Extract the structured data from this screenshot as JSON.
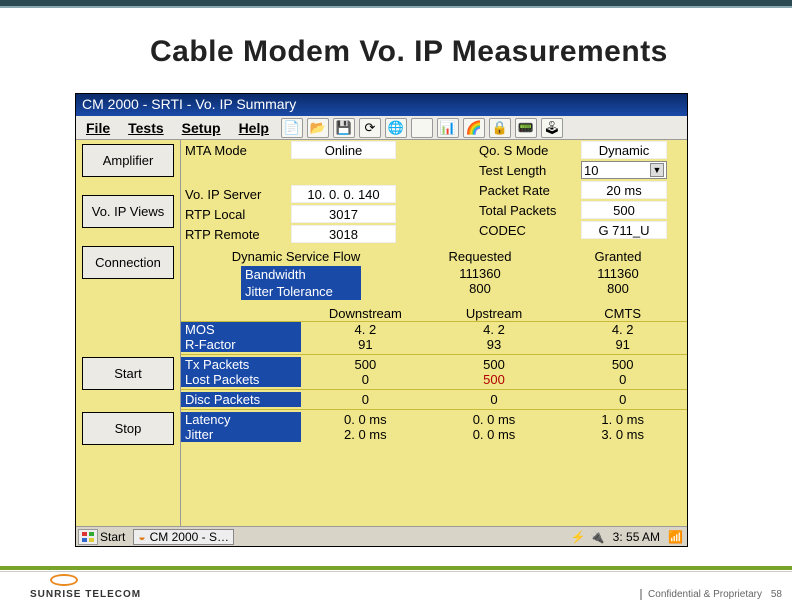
{
  "slide": {
    "title": "Cable Modem Vo. IP Measurements"
  },
  "window": {
    "title": "CM 2000 - SRTI - Vo. IP Summary"
  },
  "menu": {
    "file": "File",
    "tests": "Tests",
    "setup": "Setup",
    "help": "Help"
  },
  "toolbar": {
    "i1": "📄",
    "i2": "📂",
    "i3": "💾",
    "i4": "⟳",
    "i5": "🌐",
    "i6": "",
    "i7": "📊",
    "i8": "🌈",
    "i9": "🔒",
    "i10": "📟",
    "i11": "🕹"
  },
  "sidebar": {
    "amplifier": "Amplifier",
    "voip_views": "Vo. IP Views",
    "connection": "Connection",
    "start": "Start",
    "stop": "Stop"
  },
  "top": {
    "mta_mode": "MTA Mode",
    "mta_mode_val": "Online",
    "voip_server": "Vo. IP Server",
    "voip_server_val": "10. 0. 0. 140",
    "rtp_local": "RTP Local",
    "rtp_local_val": "3017",
    "rtp_remote": "RTP Remote",
    "rtp_remote_val": "3018",
    "qos_mode": "Qo. S Mode",
    "qos_mode_val": "Dynamic",
    "test_length": "Test Length",
    "test_length_val": "10",
    "packet_rate": "Packet Rate",
    "packet_rate_val": "20 ms",
    "total_packets": "Total Packets",
    "total_packets_val": "500",
    "codec": "CODEC",
    "codec_val": "G 711_U",
    "dsf": "Dynamic Service Flow",
    "requested": "Requested",
    "granted": "Granted",
    "bandwidth": "Bandwidth",
    "bw_req": "111360",
    "bw_grant": "111360",
    "jitter_tol": "Jitter Tolerance",
    "jt_req": "800",
    "jt_grant": "800"
  },
  "stats": {
    "cols": {
      "downstream": "Downstream",
      "upstream": "Upstream",
      "cmts": "CMTS"
    },
    "rows": [
      {
        "label": "MOS",
        "style": "dark",
        "d": "4. 2",
        "u": "4. 2",
        "c": "4. 2"
      },
      {
        "label": "R-Factor",
        "style": "dark",
        "d": "91",
        "u": "93",
        "c": "91"
      },
      {
        "label": "Tx Packets",
        "style": "dark",
        "d": "500",
        "u": "500",
        "c": "500"
      },
      {
        "label": "Lost Packets",
        "style": "dark",
        "d": "0",
        "u": "500",
        "c": "0",
        "u_color": "#b00000"
      },
      {
        "label": "Disc Packets",
        "style": "dark",
        "d": "0",
        "u": "0",
        "c": "0"
      },
      {
        "label": "Latency",
        "style": "dark",
        "d": "0. 0 ms",
        "u": "0. 0 ms",
        "c": "1. 0 ms"
      },
      {
        "label": "Jitter",
        "style": "dark",
        "d": "2. 0 ms",
        "u": "0. 0 ms",
        "c": "3. 0 ms"
      }
    ]
  },
  "taskbar": {
    "start": "Start",
    "task1": "CM 2000 - S…",
    "clock": "3: 55 AM"
  },
  "footer": {
    "logo": "SUNRISE TELECOM",
    "conf": "Confidential & Proprietary",
    "page": "58"
  }
}
